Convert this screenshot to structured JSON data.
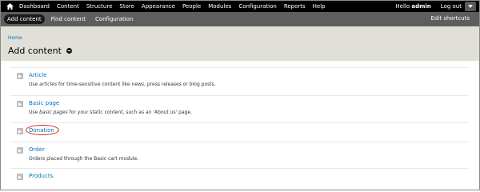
{
  "toolbar": {
    "menu": [
      "Dashboard",
      "Content",
      "Structure",
      "Store",
      "Appearance",
      "People",
      "Modules",
      "Configuration",
      "Reports",
      "Help"
    ],
    "hello_prefix": "Hello ",
    "username": "admin",
    "logout": "Log out"
  },
  "shortcuts": {
    "items": [
      "Add content",
      "Find content",
      "Configuration"
    ],
    "edit": "Edit shortcuts"
  },
  "header": {
    "breadcrumb": "Home",
    "title": "Add content"
  },
  "content_types": [
    {
      "title": "Article",
      "desc_before": "Use ",
      "desc_em": "articles",
      "desc_after": " for time-sensitive content like news, press releases or blog posts."
    },
    {
      "title": "Basic page",
      "desc_before": "Use ",
      "desc_em": "basic pages",
      "desc_after": " for your static content, such as an 'About us' page."
    },
    {
      "title": "Donation"
    },
    {
      "title": "Order",
      "desc_before": "Orders placed through the Basic cart module.",
      "desc_em": "",
      "desc_after": ""
    },
    {
      "title": "Products"
    }
  ],
  "colors": {
    "link": "#0074bd",
    "toolbar_bg": "#000000",
    "shortcuts_bg": "#5e5e5e",
    "header_bg": "#e0e0d8",
    "highlight": "#d62020"
  }
}
